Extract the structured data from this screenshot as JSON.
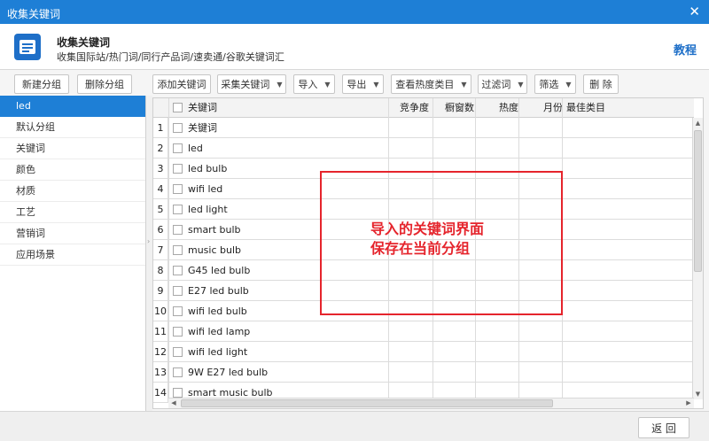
{
  "window": {
    "title": "收集关键词",
    "close_glyph": "✕"
  },
  "header": {
    "title": "收集关键词",
    "subtitle": "收集国际站/热门词/同行产品词/速卖通/谷歌关键词汇",
    "tutorial": "教程",
    "icon": "folder-doc-icon"
  },
  "group_toolbar": {
    "new_group": "新建分组",
    "delete_group": "删除分组"
  },
  "toolbar": {
    "add_keyword": "添加关键词",
    "collect_keyword": "采集关键词",
    "import": "导入",
    "export": "导出",
    "view_category": "查看热度类目",
    "filter_words": "过滤词",
    "screen": "筛选",
    "delete": "删 除"
  },
  "sidebar": {
    "items": [
      {
        "label": "led",
        "active": true
      },
      {
        "label": "默认分组"
      },
      {
        "label": "关键词"
      },
      {
        "label": "颜色"
      },
      {
        "label": "材质"
      },
      {
        "label": "工艺"
      },
      {
        "label": "营销词"
      },
      {
        "label": "应用场景"
      }
    ]
  },
  "table": {
    "columns": [
      "关键词",
      "竞争度",
      "橱窗数",
      "热度",
      "月份",
      "最佳类目"
    ],
    "rows": [
      {
        "num": "1",
        "keyword": "关键词"
      },
      {
        "num": "2",
        "keyword": "led"
      },
      {
        "num": "3",
        "keyword": "led bulb"
      },
      {
        "num": "4",
        "keyword": "wifi led"
      },
      {
        "num": "5",
        "keyword": "led light"
      },
      {
        "num": "6",
        "keyword": "smart bulb"
      },
      {
        "num": "7",
        "keyword": "music bulb"
      },
      {
        "num": "8",
        "keyword": "G45 led bulb"
      },
      {
        "num": "9",
        "keyword": "E27 led bulb"
      },
      {
        "num": "10",
        "keyword": "wifi led bulb"
      },
      {
        "num": "11",
        "keyword": "wifi led lamp"
      },
      {
        "num": "12",
        "keyword": "wifi led light"
      },
      {
        "num": "13",
        "keyword": "9W E27 led bulb"
      },
      {
        "num": "14",
        "keyword": "smart music bulb"
      }
    ]
  },
  "annotation": {
    "line1": "导入的关键词界面",
    "line2": "保存在当前分组",
    "color": "#e5242c"
  },
  "footer": {
    "back": "返 回"
  },
  "colors": {
    "accent": "#1e7fd6"
  }
}
